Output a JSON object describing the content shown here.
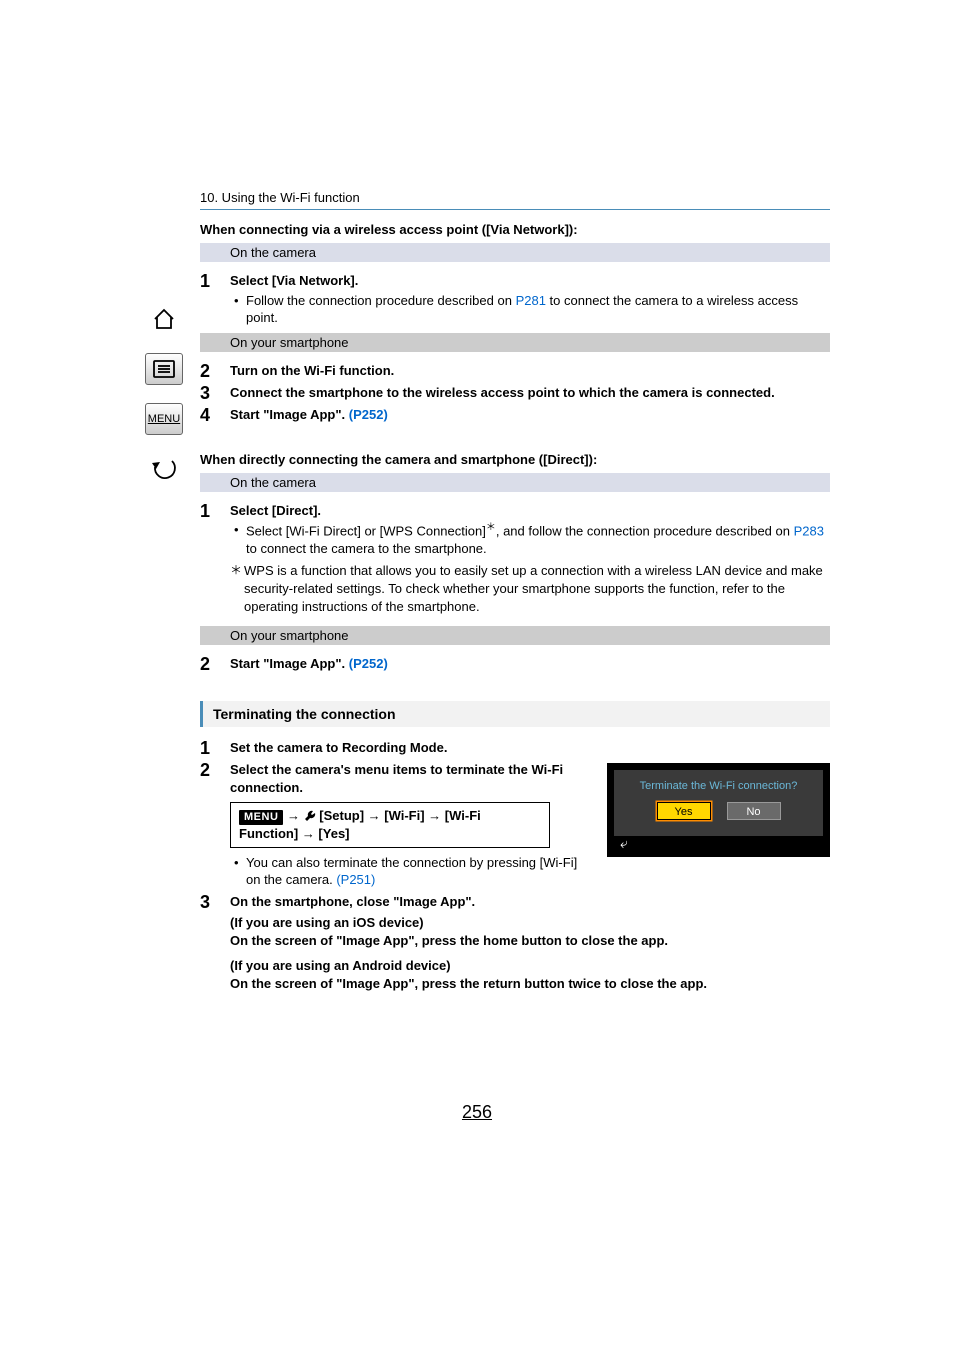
{
  "chapter": "10. Using the Wi-Fi function",
  "via_network": {
    "heading": "When connecting via a wireless access point ([Via Network]):",
    "on_camera": "On the camera",
    "step1": {
      "num": "1",
      "title": "Select [Via Network].",
      "bullet_pre": "Follow the connection procedure described on ",
      "link": "P281",
      "bullet_post": " to connect the camera to a wireless access point."
    },
    "on_sp": "On your smartphone",
    "step2": {
      "num": "2",
      "title": "Turn on the Wi-Fi function."
    },
    "step3": {
      "num": "3",
      "title": "Connect the smartphone to the wireless access point to which the camera is connected."
    },
    "step4": {
      "num": "4",
      "title_pre": "Start \"Image App\". ",
      "link": "(P252)"
    }
  },
  "direct": {
    "heading": "When directly connecting the camera and smartphone ([Direct]):",
    "on_camera": "On the camera",
    "step1": {
      "num": "1",
      "title": "Select [Direct].",
      "bullet_pre": "Select [Wi-Fi Direct] or [WPS Connection]",
      "note_mark": "＊",
      "bullet_mid": ", and follow the connection procedure described on ",
      "link": "P283",
      "bullet_post": " to connect the camera to the smartphone."
    },
    "footnote": {
      "mark": "＊",
      "text": "WPS is a function that allows you to easily set up a connection with a wireless LAN device and make security-related settings. To check whether your smartphone supports the function, refer to the operating instructions of the smartphone."
    },
    "on_sp": "On your smartphone",
    "step2": {
      "num": "2",
      "title_pre": "Start \"Image App\". ",
      "link": "(P252)"
    }
  },
  "terminate": {
    "heading": "Terminating the connection",
    "step1": {
      "num": "1",
      "title": "Set the camera to Recording Mode."
    },
    "step2": {
      "num": "2",
      "title": "Select the camera's menu items to terminate the Wi-Fi connection.",
      "menu_label": "MENU",
      "path": " [Setup] → [Wi-Fi] → [Wi-Fi Function] → [Yes]",
      "bullet_pre": "You can also terminate the connection by pressing [Wi-Fi] on the camera. ",
      "link": "(P251)"
    },
    "step3": {
      "num": "3",
      "title": "On the smartphone, close \"Image App\".",
      "ios_head": "(If you are using an iOS device)",
      "ios_body": "On the screen of \"Image App\", press the home button to close the app.",
      "and_head": "(If you are using an Android device)",
      "and_body": "On the screen of \"Image App\", press the return button twice to close the app."
    },
    "dialog": {
      "title": "Terminate the Wi-Fi connection?",
      "yes": "Yes",
      "no": "No"
    }
  },
  "page_number": "256",
  "sidebar_menu_label": "MENU"
}
